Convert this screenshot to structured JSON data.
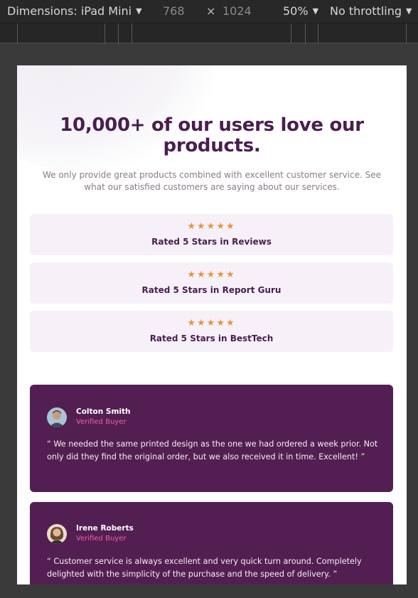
{
  "devtools": {
    "dimensions_label": "Dimensions: iPad Mini",
    "width": "768",
    "times": "×",
    "height": "1024",
    "zoom": "50%",
    "throttling": "No throttling"
  },
  "page": {
    "heading": "10,000+ of our users love our products.",
    "subtext": "We only provide great products combined with excellent customer service. See what our satisfied customers are saying about our services.",
    "ratings": [
      {
        "stars": "★★★★★",
        "label": "Rated 5 Stars in Reviews"
      },
      {
        "stars": "★★★★★",
        "label": "Rated 5 Stars in Report Guru"
      },
      {
        "stars": "★★★★★",
        "label": "Rated 5 Stars in BestTech"
      }
    ],
    "testimonials": [
      {
        "name": "Colton Smith",
        "badge": "Verified Buyer",
        "quote": "“ We needed the same printed design as the one we had ordered a week prior. Not only did they find the original order, but we also received it in time. Excellent! ”"
      },
      {
        "name": "Irene Roberts",
        "badge": "Verified Buyer",
        "quote": "“ Customer service is always excellent and very quick turn around. Completely delighted with the simplicity of the purchase and the speed of delivery. ”"
      }
    ]
  },
  "colors": {
    "heading": "#4a1d4f",
    "card_bg": "#531f52",
    "star": "#e8933e",
    "verified": "#ef5fa8",
    "rating_bg": "#f6f1f8"
  },
  "icons": [
    "dropdown-triangle-icon",
    "star-icon",
    "avatar-photo"
  ]
}
